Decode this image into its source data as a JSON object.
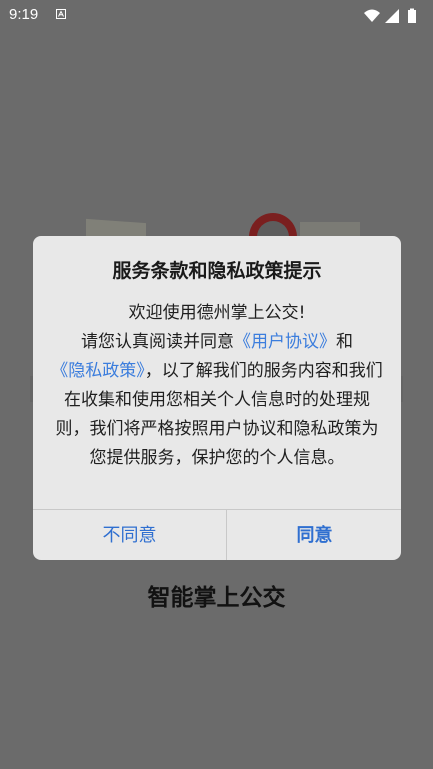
{
  "status_bar": {
    "time": "9:19"
  },
  "app": {
    "name": "智能掌上公交"
  },
  "dialog": {
    "title": "服务条款和隐私政策提示",
    "line1": "欢迎使用德州掌上公交!",
    "line2_prefix": "请您认真阅读并同意",
    "user_agreement_link": "《用户协议》",
    "line2_and": "和",
    "privacy_link": "《隐私政策》",
    "line3_rest": "，以了解我们的服务内容和我们在收集和使用您相关个人信息时的处理规则，我们将严格按照用户协议和隐私政策为您提供服务，保护您的个人信息。",
    "decline_label": "不同意",
    "agree_label": "同意"
  },
  "colors": {
    "link": "#3b7ddd",
    "button": "#2f6fd0",
    "overlay": "#6b6b6b"
  }
}
